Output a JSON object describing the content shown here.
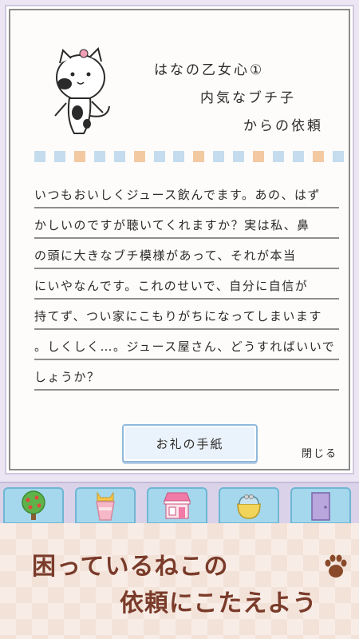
{
  "letter": {
    "title_lines": [
      "はなの乙女心①",
      "内気なブチ子",
      "からの依頼"
    ],
    "body_lines": [
      "いつもおいしくジュース飲んでます。あの、はず",
      "かしいのですが聴いてくれますか？実は私、鼻",
      "の頭に大きなブチ模様があって、それが本当",
      "にいやなんです。これのせいで、自分に自信が",
      "持てず、つい家にこもりがちになってしまいます",
      "。しくしく…。ジュース屋さん、どうすればいいで",
      "しょうか？"
    ],
    "thanks_button": "お礼の手紙",
    "close_label": "閉じる"
  },
  "toolbar": {
    "items": [
      {
        "icon": "apple-tree-icon"
      },
      {
        "icon": "juice-cup-icon"
      },
      {
        "icon": "shop-icon"
      },
      {
        "icon": "coin-purse-icon"
      },
      {
        "icon": "door-icon"
      }
    ]
  },
  "promo": {
    "line1": "困っているねこの",
    "line2": "依頼にこたえよう",
    "icon": "paw-icon"
  },
  "colors": {
    "stamp_blue": "#c4dcee",
    "stamp_orange": "#f3c9a2",
    "toolbar_tab": "#a5d8ec",
    "promo_text": "#7a3b2a"
  }
}
